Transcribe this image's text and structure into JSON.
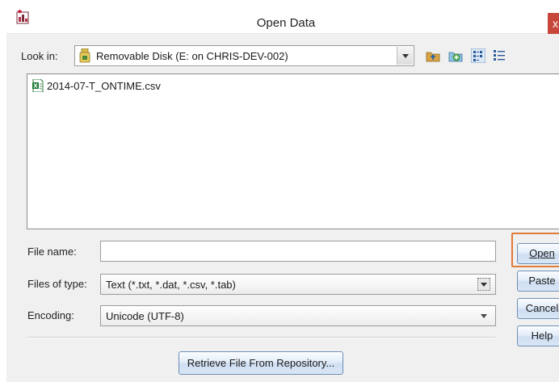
{
  "window": {
    "title": "Open Data",
    "close_label": "x",
    "app_icon": "spss-app-icon"
  },
  "look_in": {
    "label": "Look in:",
    "value": "Removable Disk (E: on CHRIS-DEV-002)",
    "icon": "removable-drive-icon"
  },
  "toolbar": {
    "icons": [
      "up-folder-icon",
      "new-folder-icon",
      "list-view-icon",
      "details-view-icon"
    ]
  },
  "files": [
    {
      "name": "2014-07-T_ONTIME.csv",
      "icon": "csv-file-icon"
    }
  ],
  "file_name": {
    "label": "File name:",
    "value": ""
  },
  "files_of_type": {
    "label": "Files of type:",
    "value": "Text (*.txt, *.dat, *.csv, *.tab)"
  },
  "encoding": {
    "label": "Encoding:",
    "value": "Unicode (UTF-8)"
  },
  "buttons": {
    "open": "Open",
    "paste": "Paste",
    "cancel": "Cancel",
    "help": "Help",
    "retrieve": "Retrieve File From Repository..."
  },
  "colors": {
    "highlight": "#e07b39",
    "close": "#c7483b"
  }
}
